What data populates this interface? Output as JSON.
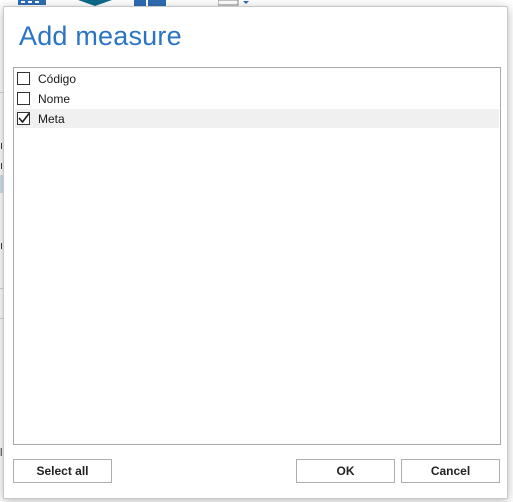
{
  "dialog": {
    "title": "Add measure",
    "items": [
      {
        "label": "Código",
        "checked": false
      },
      {
        "label": "Nome",
        "checked": false
      },
      {
        "label": "Meta",
        "checked": true
      }
    ],
    "buttons": {
      "select_all": "Select all",
      "ok": "OK",
      "cancel": "Cancel"
    }
  },
  "background": {
    "partial_texts": [
      "ıs",
      "ıs",
      "ıs",
      "la"
    ]
  },
  "colors": {
    "title": "#2b74c4",
    "ribbon_teal": "#0e6a8a",
    "ribbon_blue": "#2e6db4"
  }
}
